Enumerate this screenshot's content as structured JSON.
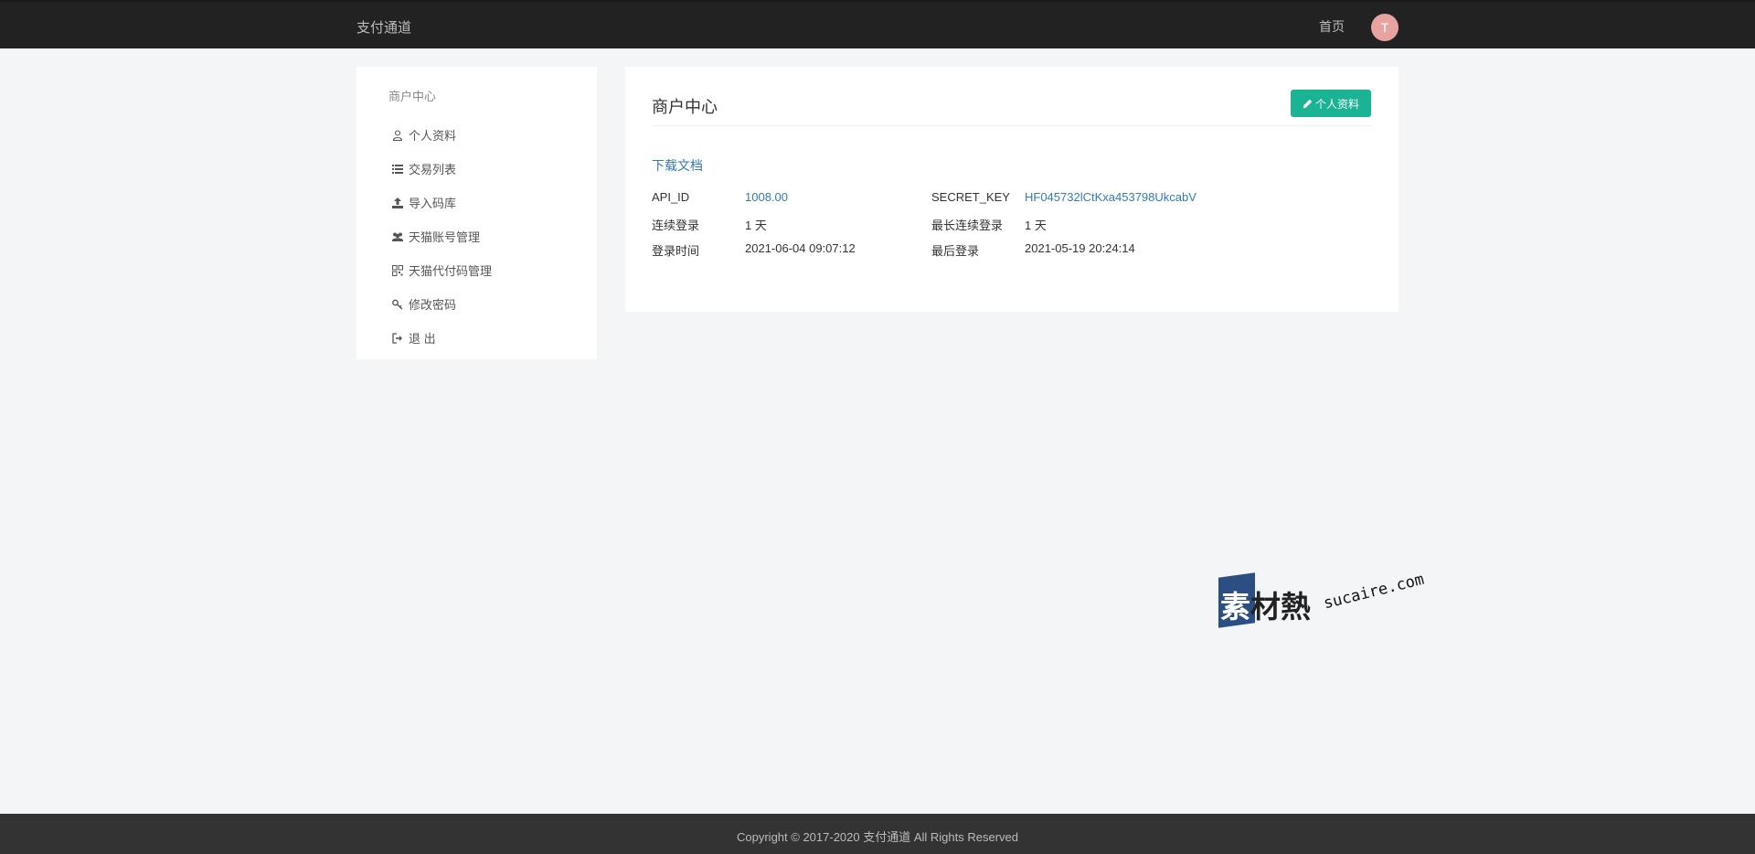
{
  "header": {
    "brand": "支付通道",
    "nav_home": "首页",
    "avatar_initial": "T"
  },
  "sidebar": {
    "heading": "商户中心",
    "items": [
      {
        "label": "个人资料",
        "icon": "user-icon"
      },
      {
        "label": "交易列表",
        "icon": "list-icon"
      },
      {
        "label": "导入码库",
        "icon": "upload-icon"
      },
      {
        "label": "天猫账号管理",
        "icon": "users-icon"
      },
      {
        "label": "天猫代付码管理",
        "icon": "qrcode-icon"
      },
      {
        "label": "修改密码",
        "icon": "key-icon"
      },
      {
        "label": "退 出",
        "icon": "sign-out-icon"
      }
    ]
  },
  "panel": {
    "title": "商户中心",
    "profile_button": "个人资料",
    "download_link": "下载文档",
    "info": {
      "api_id_label": "API_ID",
      "api_id_value": "1008.00",
      "secret_key_label": "SECRET_KEY",
      "secret_key_value": "HF045732lCtKxa453798UkcabV",
      "consecutive_login_label": "连续登录",
      "consecutive_login_value": "1 天",
      "longest_consecutive_label": "最长连续登录",
      "longest_consecutive_value": "1 天",
      "login_time_label": "登录时间",
      "login_time_value": "2021-06-04 09:07:12",
      "last_login_label": "最后登录",
      "last_login_value": "2021-05-19 20:24:14"
    }
  },
  "watermark": {
    "logo_first": "素",
    "logo_rest": "材熱",
    "domain": "sucaire.com"
  },
  "footer": {
    "copyright": "Copyright © 2017-2020 支付通道 All Rights Reserved"
  },
  "colors": {
    "topbar": "#222222",
    "accent_green": "#1ab394",
    "link_blue": "#337ab7",
    "background": "#f4f5f7"
  }
}
